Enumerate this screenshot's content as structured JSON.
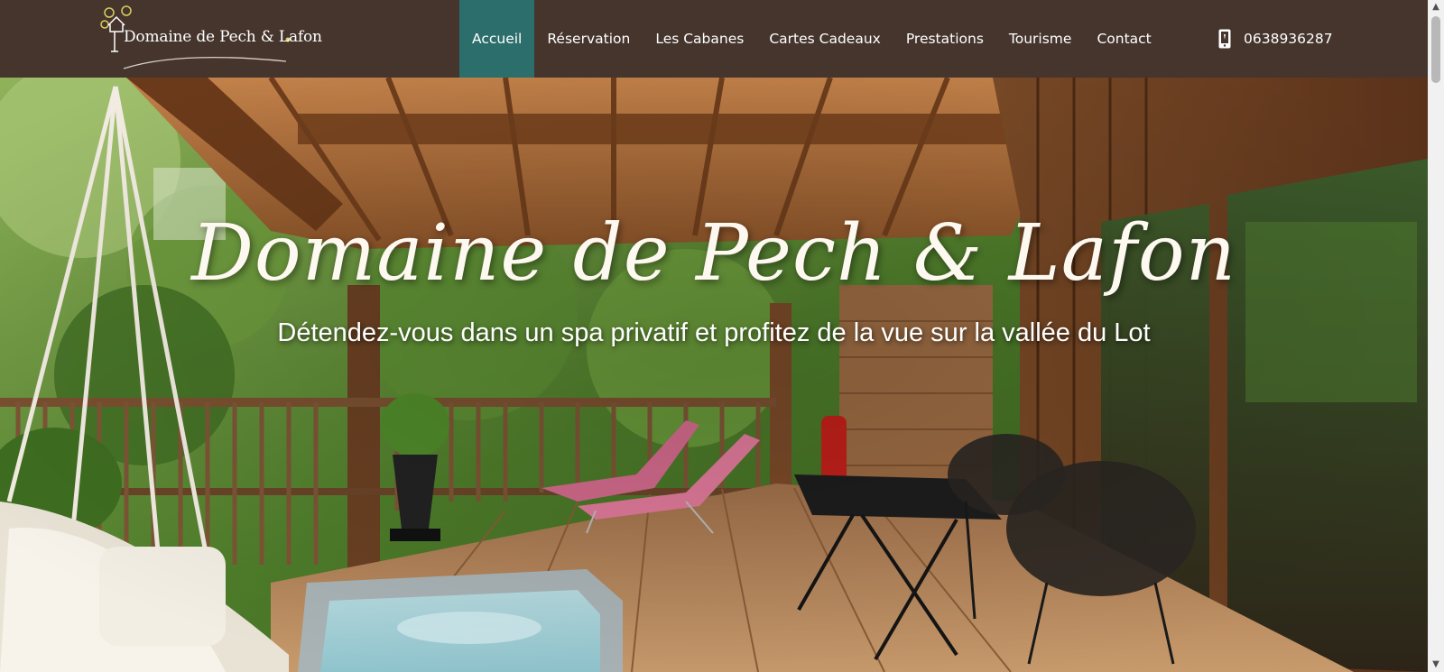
{
  "brand": {
    "name": "Domaine de Pech & Lafon",
    "logo_icon": "house-tree-logo-icon"
  },
  "nav": {
    "items": [
      {
        "label": "Accueil",
        "active": true
      },
      {
        "label": "Réservation",
        "active": false
      },
      {
        "label": "Les Cabanes",
        "active": false
      },
      {
        "label": "Cartes Cadeaux",
        "active": false
      },
      {
        "label": "Prestations",
        "active": false
      },
      {
        "label": "Tourisme",
        "active": false
      },
      {
        "label": "Contact",
        "active": false
      }
    ],
    "phone": "0638936287",
    "phone_icon": "mobile-phone-icon"
  },
  "hero": {
    "title": "Domaine de Pech & Lafon",
    "subtitle": "Détendez-vous dans un spa privatif et profitez de la vue sur la vallée du Lot",
    "image": "treehouse-terrace-photo"
  },
  "colors": {
    "header_bg": "#45352d",
    "active_nav_bg": "#2c6e6c",
    "text": "#ffffff"
  }
}
